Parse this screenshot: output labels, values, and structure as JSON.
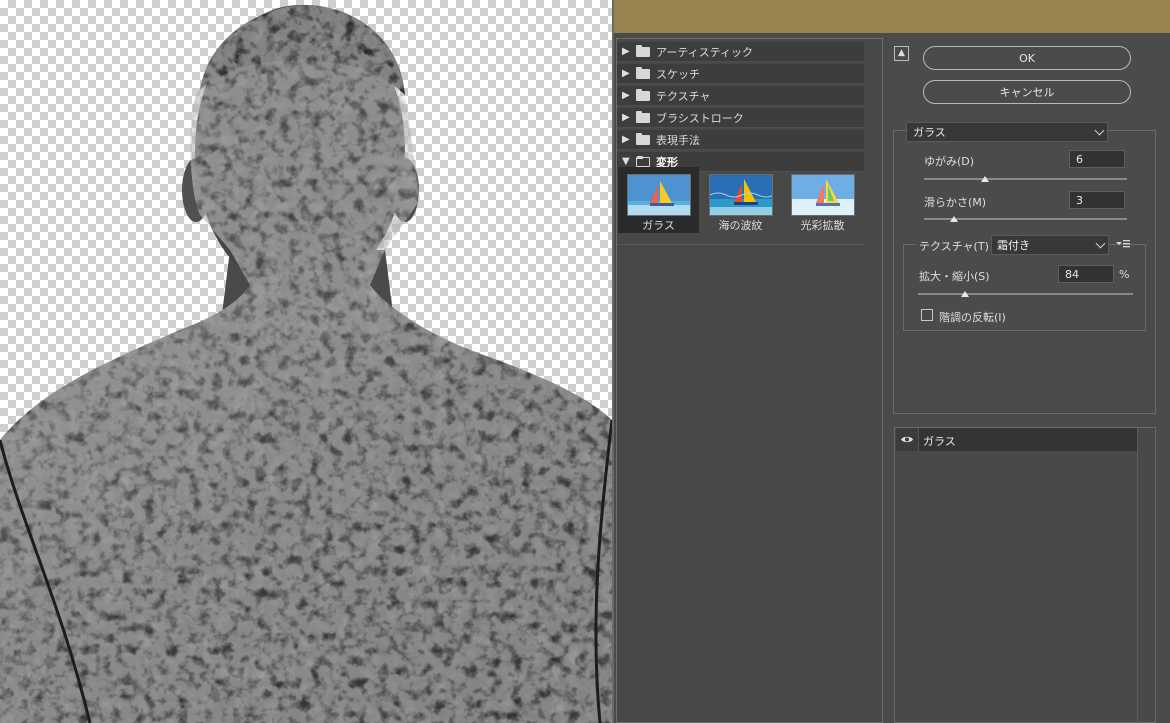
{
  "gallery": {
    "folders": [
      {
        "label": "アーティスティック",
        "open": false
      },
      {
        "label": "スケッチ",
        "open": false
      },
      {
        "label": "テクスチャ",
        "open": false
      },
      {
        "label": "ブラシストローク",
        "open": false
      },
      {
        "label": "表現手法",
        "open": false
      },
      {
        "label": "変形",
        "open": true
      }
    ],
    "thumbnails": [
      {
        "label": "ガラス",
        "selected": true
      },
      {
        "label": "海の波紋",
        "selected": false
      },
      {
        "label": "光彩拡散",
        "selected": false
      }
    ]
  },
  "buttons": {
    "ok": "OK",
    "cancel": "キャンセル"
  },
  "filter": {
    "selected": "ガラス",
    "distortion": {
      "label": "ゆがみ(D)",
      "value": "6",
      "level": 0.3
    },
    "smoothness": {
      "label": "滑らかさ(M)",
      "value": "3",
      "level": 0.15
    },
    "texture": {
      "label": "テクスチャ(T) :",
      "selected": "霜付き"
    },
    "scaling": {
      "label": "拡大・縮小(S)",
      "value": "84",
      "unit": "%",
      "level": 0.22
    },
    "invert": {
      "label": "階調の反転(I)",
      "checked": false
    }
  },
  "layers": [
    {
      "label": "ガラス",
      "visible": true
    }
  ],
  "colors": {
    "titlebar": "#988350",
    "panel": "#4b4b4b"
  }
}
